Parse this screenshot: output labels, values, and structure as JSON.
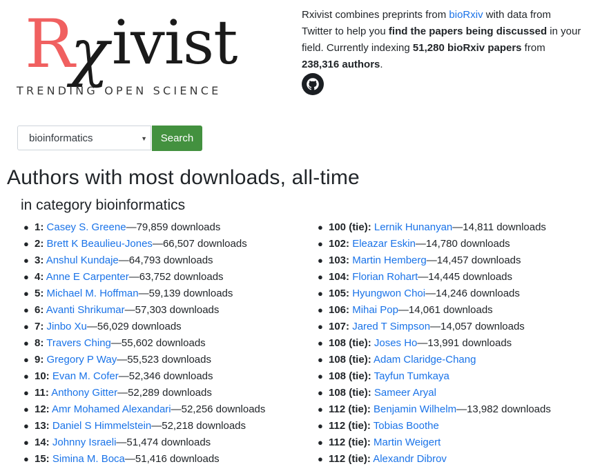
{
  "logo": {
    "r": "R",
    "chi": "χ",
    "rest": "ivist",
    "tagline": "TRENDING OPEN SCIENCE"
  },
  "intro": {
    "t1": "Rxivist combines preprints from ",
    "link": "bioRxiv",
    "t2": " with data from Twitter to help you ",
    "bold1": "find the papers being discussed",
    "t3": " in your field. Currently indexing ",
    "bold2": "51,280 bioRxiv papers",
    "t4": " from ",
    "bold3": "238,316 authors",
    "t5": "."
  },
  "search": {
    "selected": "bioinformatics",
    "button": "Search"
  },
  "heading": "Authors with most downloads, all-time",
  "subheading": "in category bioinformatics",
  "left": [
    {
      "rank": "1:",
      "name": "Casey S. Greene",
      "dl": "—79,859 downloads"
    },
    {
      "rank": "2:",
      "name": "Brett K Beaulieu-Jones",
      "dl": "—66,507 downloads"
    },
    {
      "rank": "3:",
      "name": "Anshul Kundaje",
      "dl": "—64,793 downloads"
    },
    {
      "rank": "4:",
      "name": "Anne E Carpenter",
      "dl": "—63,752 downloads"
    },
    {
      "rank": "5:",
      "name": "Michael M. Hoffman",
      "dl": "—59,139 downloads"
    },
    {
      "rank": "6:",
      "name": "Avanti Shrikumar",
      "dl": "—57,303 downloads"
    },
    {
      "rank": "7:",
      "name": "Jinbo Xu",
      "dl": "—56,029 downloads"
    },
    {
      "rank": "8:",
      "name": "Travers Ching",
      "dl": "—55,602 downloads"
    },
    {
      "rank": "9:",
      "name": "Gregory P Way",
      "dl": "—55,523 downloads"
    },
    {
      "rank": "10:",
      "name": "Evan M. Cofer",
      "dl": "—52,346 downloads"
    },
    {
      "rank": "11:",
      "name": "Anthony Gitter",
      "dl": "—52,289 downloads"
    },
    {
      "rank": "12:",
      "name": "Amr Mohamed Alexandari",
      "dl": "—52,256 downloads"
    },
    {
      "rank": "13:",
      "name": "Daniel S Himmelstein",
      "dl": "—52,218 downloads"
    },
    {
      "rank": "14:",
      "name": "Johnny Israeli",
      "dl": "—51,474 downloads"
    },
    {
      "rank": "15:",
      "name": "Simina M. Boca",
      "dl": "—51,416 downloads"
    }
  ],
  "right": [
    {
      "rank": "100 (tie):",
      "name": "Lernik Hunanyan",
      "dl": "—14,811 downloads"
    },
    {
      "rank": "102:",
      "name": "Eleazar Eskin",
      "dl": "—14,780 downloads"
    },
    {
      "rank": "103:",
      "name": "Martin Hemberg",
      "dl": "—14,457 downloads"
    },
    {
      "rank": "104:",
      "name": "Florian Rohart",
      "dl": "—14,445 downloads"
    },
    {
      "rank": "105:",
      "name": "Hyungwon Choi",
      "dl": "—14,246 downloads"
    },
    {
      "rank": "106:",
      "name": "Mihai Pop",
      "dl": "—14,061 downloads"
    },
    {
      "rank": "107:",
      "name": "Jared T Simpson",
      "dl": "—14,057 downloads"
    },
    {
      "rank": "108 (tie):",
      "name": "Joses Ho",
      "dl": "—13,991 downloads"
    },
    {
      "rank": "108 (tie):",
      "name": "Adam Claridge-Chang",
      "dl": ""
    },
    {
      "rank": "108 (tie):",
      "name": "Tayfun Tumkaya",
      "dl": ""
    },
    {
      "rank": "108 (tie):",
      "name": "Sameer Aryal",
      "dl": ""
    },
    {
      "rank": "112 (tie):",
      "name": "Benjamin Wilhelm",
      "dl": "—13,982 downloads"
    },
    {
      "rank": "112 (tie):",
      "name": "Tobias Boothe",
      "dl": ""
    },
    {
      "rank": "112 (tie):",
      "name": "Martin Weigert",
      "dl": ""
    },
    {
      "rank": "112 (tie):",
      "name": "Alexandr Dibrov",
      "dl": ""
    }
  ],
  "colors": {
    "link": "#1a73e8",
    "logo_r": "#f06060",
    "button": "#43913f"
  },
  "icons": {
    "github": "github-icon",
    "caret": "chevron-down-icon"
  }
}
